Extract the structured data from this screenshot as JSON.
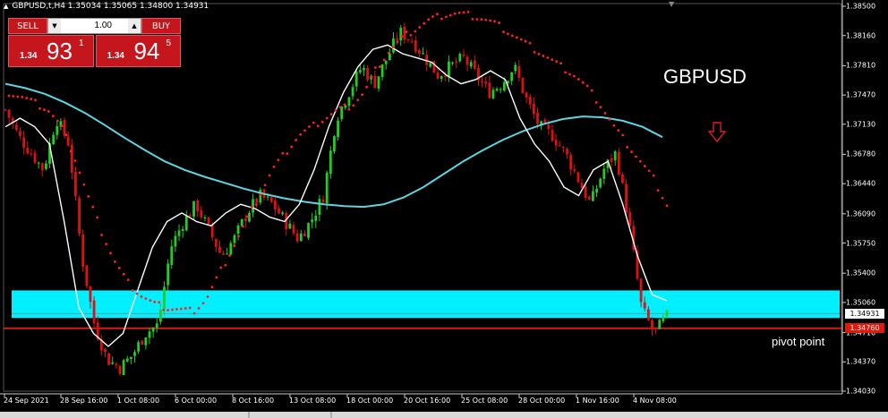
{
  "header": {
    "symbol_line": "GBPUSD,t,H4  1.35034 1.35065 1.34800 1.34931"
  },
  "trade_panel": {
    "sell_label": "SELL",
    "buy_label": "BUY",
    "lot_value": "1.00",
    "sell_prefix": "1.34",
    "sell_big": "93",
    "sell_sup": "1",
    "buy_prefix": "1.34",
    "buy_big": "94",
    "buy_sup": "5"
  },
  "annotations": {
    "symbol": "GBPUSD",
    "pivot": "pivot point"
  },
  "colors": {
    "bull": "#22cc22",
    "bear": "#dd1111",
    "sar": "#ff2222",
    "ema": "#ffffff",
    "ma_long": "#5fd3e0",
    "zone": "#00f0ff",
    "pivot_line": "#e01a0a",
    "arrow": "#d92020"
  },
  "chart_data": {
    "type": "candlestick",
    "title": "GBPUSD",
    "timeframe": "H4",
    "ylim": [
      1.3403,
      1.385
    ],
    "price_ticks": [
      "1.38500",
      "1.38160",
      "1.37810",
      "1.37470",
      "1.37130",
      "1.36780",
      "1.36440",
      "1.36090",
      "1.35750",
      "1.35400",
      "1.35060",
      "1.34710",
      "1.34370",
      "1.34030"
    ],
    "time_ticks": [
      "24 Sep 2021",
      "28 Sep 16:00",
      "1 Oct 08:00",
      "6 Oct 00:00",
      "8 Oct 16:00",
      "13 Oct 08:00",
      "18 Oct 00:00",
      "20 Oct 16:00",
      "25 Oct 08:00",
      "28 Oct 00:00",
      "1 Nov 16:00",
      "4 Nov 08:00"
    ],
    "current_price": "1.34931",
    "pivot_price": "1.34760",
    "pivot_point": 1.3476,
    "zone": [
      1.3488,
      1.352
    ],
    "close_path": [
      1.373,
      1.37,
      1.368,
      1.366,
      1.372,
      1.369,
      1.356,
      1.348,
      1.344,
      1.343,
      1.3445,
      1.347,
      1.348,
      1.357,
      1.36,
      1.362,
      1.359,
      1.356,
      1.358,
      1.361,
      1.363,
      1.362,
      1.36,
      1.358,
      1.36,
      1.363,
      1.372,
      1.375,
      1.378,
      1.376,
      1.379,
      1.382,
      1.381,
      1.379,
      1.377,
      1.378,
      1.379,
      1.377,
      1.375,
      1.376,
      1.378,
      1.374,
      1.371,
      1.37,
      1.368,
      1.365,
      1.362,
      1.366,
      1.368,
      1.36,
      1.35,
      1.347,
      1.349
    ],
    "ema_path": [
      1.371,
      1.372,
      1.371,
      1.369,
      1.36,
      1.35,
      1.347,
      1.3455,
      1.347,
      1.352,
      1.357,
      1.36,
      1.361,
      1.36,
      1.3595,
      1.361,
      1.362,
      1.3615,
      1.3605,
      1.36,
      1.362,
      1.366,
      1.371,
      1.375,
      1.378,
      1.38,
      1.3805,
      1.3795,
      1.379,
      1.3785,
      1.377,
      1.376,
      1.3765,
      1.3775,
      1.3765,
      1.372,
      1.369,
      1.367,
      1.364,
      1.363,
      1.366,
      1.367,
      1.362,
      1.356,
      1.3515,
      1.3508
    ],
    "ma_long_path": [
      1.376,
      1.3755,
      1.3748,
      1.3738,
      1.3726,
      1.3712,
      1.3697,
      1.3683,
      1.367,
      1.366,
      1.3652,
      1.3645,
      1.3638,
      1.3632,
      1.3627,
      1.3623,
      1.362,
      1.3618,
      1.3617,
      1.362,
      1.3628,
      1.364,
      1.3655,
      1.367,
      1.3683,
      1.3695,
      1.3705,
      1.3713,
      1.3719,
      1.3722,
      1.3721,
      1.3717,
      1.371,
      1.3698
    ],
    "sar_high": [
      1.374,
      1.3735,
      1.3728,
      1.372,
      1.37,
      1.3665,
      1.362,
      1.358,
      1.3545,
      1.352,
      1.3505,
      1.3495,
      1.349,
      1.3488,
      1.3486,
      1.35,
      1.353,
      1.356,
      1.359,
      1.362,
      1.365,
      1.367,
      1.369,
      1.37,
      1.371,
      1.372,
      1.3725,
      1.374,
      1.377,
      1.379,
      1.3805,
      1.3815,
      1.3825,
      1.383,
      1.3832,
      1.383,
      1.3826,
      1.382,
      1.381,
      1.38,
      1.379,
      1.378,
      1.377,
      1.376,
      1.3745,
      1.3725,
      1.37,
      1.368,
      1.366,
      1.364,
      1.361
    ],
    "sar_low": [
      1.366,
      1.3662,
      1.3664,
      1.3667,
      1.367,
      1.3673,
      1.3677,
      1.368,
      1.3683,
      1.3688,
      1.3693,
      1.3698,
      1.3703,
      1.371,
      1.3717,
      1.3724,
      1.3731,
      1.374,
      1.3749,
      1.375,
      1.3752,
      1.3754,
      1.3756,
      1.3758,
      1.376,
      1.3762,
      1.3764,
      1.3765,
      1.3766,
      1.3767
    ]
  }
}
